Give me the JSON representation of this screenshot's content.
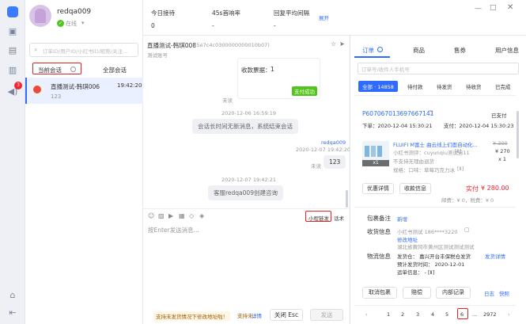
{
  "user": {
    "name": "redqa009",
    "status": "在线"
  },
  "search": {
    "placeholder": "订单ID/用户ID/小红书ID/昵称/关注..."
  },
  "session_tabs": {
    "current": "当前会话",
    "all": "全部会话"
  },
  "sidebar_badge": "3",
  "conversation": {
    "name": "直播测试-韩琪006",
    "time": "19:42:20",
    "preview": "123"
  },
  "stats": [
    {
      "label": "今日接待",
      "value": "0"
    },
    {
      "label": "45s首响率",
      "value": "-"
    },
    {
      "label": "回复平均间隔",
      "value": "-"
    }
  ],
  "stats_expand": "展开",
  "chat": {
    "title": "直播测试-韩琪008",
    "id": "(5e7c4c0300000000010b07)",
    "subtitle": "测试账号",
    "card_label": "收款票据：",
    "card_value": "1",
    "card_status": "支付成功",
    "unread1": "未读",
    "ts1": "2020-12-06 16:59:19",
    "sys1": "会话长时间无新消息，系统结束会话",
    "sender": "redqa009",
    "ts2": "2020-12-07 19:42:20",
    "unread2": "未读",
    "msg": "123",
    "ts3": "2020-12-07 19:42:21",
    "sys2": "客服redqa009创建咨询",
    "quick_reply": "小程链发",
    "quick_reply_more": "话术",
    "input_placeholder": "按Enter发送消息..."
  },
  "footer": {
    "notice": "支持未发货情况下修改地址啦！",
    "notice_more": "支持未、",
    "detail": "详情",
    "close_button": "关闭 Esc",
    "send_button": "发送"
  },
  "right_tabs": [
    "订单",
    "商品",
    "售券",
    "用户信息"
  ],
  "order_search_placeholder": "订单号/收件人手机号",
  "order_filters": [
    "全部 · 14858",
    "待付款",
    "待发货",
    "待收货",
    "已完成"
  ],
  "order": {
    "id": "P607067013697667141",
    "status": "已支付",
    "order_time": "下单：2020-12-04 15:30:21",
    "pay_time": "支付：2020-12-04 15:30:23",
    "product_name": "FLUIFI M富士 曲云线上们面自动化...",
    "orig_price": "¥ 300",
    "price": "¥ 270",
    "qty": "x 1",
    "shop": "小红书测评：cuyunqiu测试自11",
    "shop_tag": "[Ⅱ]",
    "no_refund": "不支持无理由退货",
    "spec": "规格：口味：草莓巧克力冰",
    "spec_tag": "[Ⅱ]",
    "thumb_qty": "x1",
    "detail_btn": "优惠详情",
    "pay_info_btn": "收款信息",
    "paid_label": "实付",
    "paid_amount": "¥ 280.00",
    "fees": "邮费：¥ 0，税费：¥ 0",
    "bag_label": "包裹备注",
    "bag_add": "新增",
    "recv_label": "收货信息",
    "recv_name": "小红书测试  186****3220",
    "recv_edit": "修改地址",
    "recv_addr": "湖北省黄冈市黄州区测试测试测试",
    "logi_label": "物流信息",
    "logi_ship": "发货仓：  嘉兴开台丰保税仓发货",
    "logi_detail": "发货详情",
    "logi_eta": "预计发货时间：  2020-12-01",
    "logi_tracking": "运单信息：  -   [Ⅱ]",
    "btn_cancel": "取消包裹",
    "btn_compensate": "赔偿",
    "btn_internal": "内部记录",
    "log_link": "日志",
    "quick_link": "快照"
  },
  "pagination": {
    "pages": [
      "1",
      "2",
      "3",
      "4",
      "5",
      "6"
    ],
    "last": "2972",
    "ellipsis": "..."
  }
}
